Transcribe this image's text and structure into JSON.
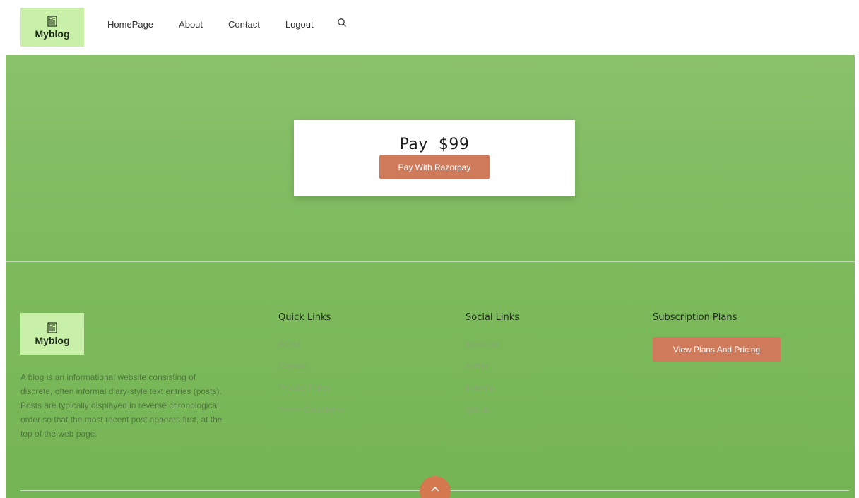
{
  "header": {
    "logo_text": "Myblog",
    "nav": [
      "HomePage",
      "About",
      "Contact",
      "Logout"
    ],
    "search_icon": "search-icon"
  },
  "payment": {
    "title": "Pay  $99",
    "button": "Pay With Razorpay"
  },
  "footer": {
    "logo_text": "Myblog",
    "description": "A blog is an informational website consisting of discrete, often informal diary-style text entries (posts). Posts are typically displayed in reverse chronological order so that the most recent post appears first, at the top of the web page.",
    "quick_links": {
      "title": "Quick Links",
      "items": [
        "About",
        "Contact",
        "Privacy Policy",
        "Terms Conditions"
      ]
    },
    "social_links": {
      "title": "Social Links",
      "items": [
        "facebook",
        "twitter",
        "linkedin",
        "github"
      ]
    },
    "subscription": {
      "title": "Subscription Plans",
      "button": "View Plans And Pricing"
    },
    "scroll_top_icon": "chevron-up-icon"
  },
  "colors": {
    "green": "#7cba5c",
    "logo_bg": "#c9f0a8",
    "accent": "#cf7a5a"
  }
}
